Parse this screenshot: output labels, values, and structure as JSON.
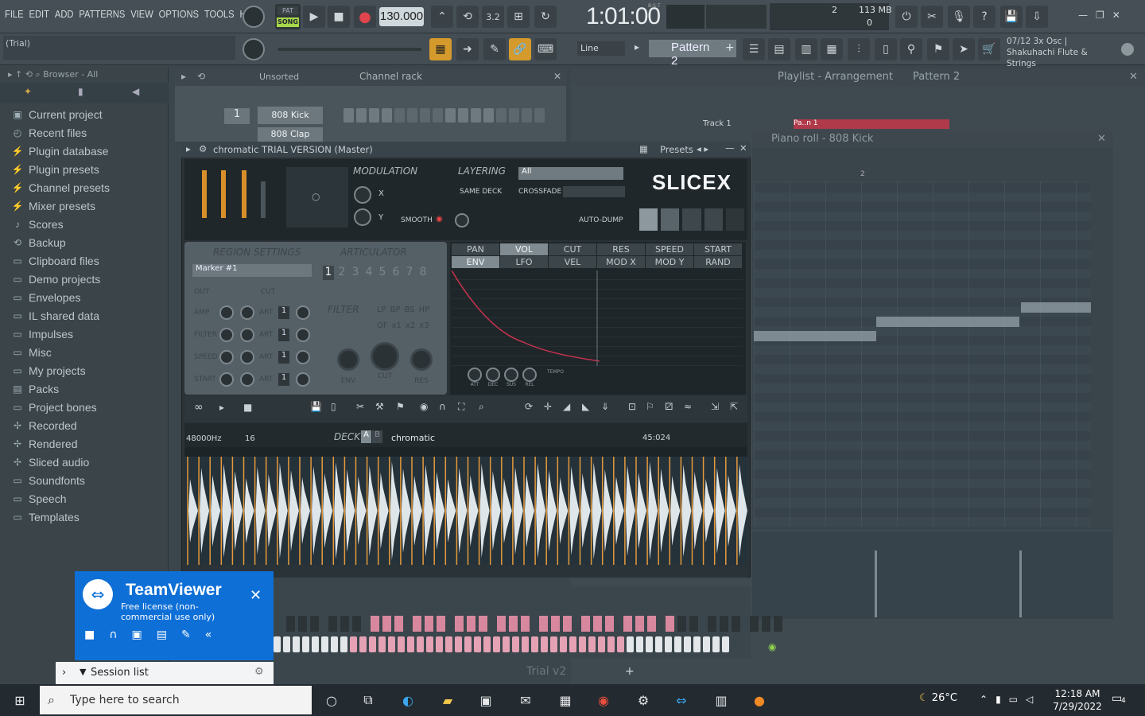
{
  "menu": [
    "FILE",
    "EDIT",
    "ADD",
    "PATTERNS",
    "VIEW",
    "OPTIONS",
    "TOOLS",
    "HELP"
  ],
  "transport": {
    "pat": "PAT",
    "song": "SONG",
    "tempo": "130.000",
    "timecode": "1:01:00",
    "bst": "B:S:T"
  },
  "monitor": {
    "cpu": "2",
    "memory": "113 MB",
    "voices": "0"
  },
  "hint": "(Trial)",
  "snap": "Line",
  "pattern": "Pattern 2",
  "info": {
    "line1": "07/12  3x Osc |",
    "line2": "Shakuhachi Flute & Strings"
  },
  "browser": {
    "title": "Browser - All",
    "items": [
      {
        "icon": "project-icon",
        "label": "Current project"
      },
      {
        "icon": "recent-icon",
        "label": "Recent files"
      },
      {
        "icon": "plugin-icon",
        "label": "Plugin database"
      },
      {
        "icon": "plugin-icon",
        "label": "Plugin presets"
      },
      {
        "icon": "preset-icon",
        "label": "Channel presets"
      },
      {
        "icon": "preset-icon",
        "label": "Mixer presets"
      },
      {
        "icon": "note-icon",
        "label": "Scores"
      },
      {
        "icon": "backup-icon",
        "label": "Backup"
      },
      {
        "icon": "folder-icon",
        "label": "Clipboard files"
      },
      {
        "icon": "folder-icon",
        "label": "Demo projects"
      },
      {
        "icon": "folder-icon",
        "label": "Envelopes"
      },
      {
        "icon": "folder-icon",
        "label": "IL shared data"
      },
      {
        "icon": "folder-icon",
        "label": "Impulses"
      },
      {
        "icon": "folder-icon",
        "label": "Misc"
      },
      {
        "icon": "folder-icon",
        "label": "My projects"
      },
      {
        "icon": "packs-icon",
        "label": "Packs"
      },
      {
        "icon": "folder-icon",
        "label": "Project bones"
      },
      {
        "icon": "audio-icon",
        "label": "Recorded"
      },
      {
        "icon": "audio-icon",
        "label": "Rendered"
      },
      {
        "icon": "audio-icon",
        "label": "Sliced audio"
      },
      {
        "icon": "folder-icon",
        "label": "Soundfonts"
      },
      {
        "icon": "folder-icon",
        "label": "Speech"
      },
      {
        "icon": "folder-icon",
        "label": "Templates"
      }
    ]
  },
  "channel_rack": {
    "filter": "Unsorted",
    "title": "Channel rack",
    "channel_number": "1",
    "channel1": "808 Kick",
    "channel2": "808 Clap"
  },
  "playlist": {
    "title": "Playlist - Arrangement",
    "pattern": "Pattern 2",
    "track": "Track 1",
    "clip": "Pa..n 1"
  },
  "piano_roll": {
    "title": "Piano roll - 808 Kick",
    "bar": "2"
  },
  "slicex": {
    "title": "chromatic TRIAL VERSION (Master)",
    "presets": "Presets",
    "modulation": "MODULATION",
    "x": "X",
    "y": "Y",
    "smooth": "SMOOTH",
    "layering": "LAYERING",
    "layer_value": "All",
    "same_deck": "SAME DECK",
    "crossfade": "CROSSFADE",
    "auto_dump": "AUTO-DUMP",
    "logo": "SLICEX",
    "region": "REGION SETTINGS",
    "marker": "Marker #1",
    "out": "OUT",
    "cut": "CUT",
    "rows": [
      "AMP",
      "FILTER",
      "SPEED",
      "START"
    ],
    "art": "ART",
    "articulator": "ARTICULATOR",
    "art_numbers": [
      "1",
      "2",
      "3",
      "4",
      "5",
      "6",
      "7",
      "8"
    ],
    "filter": "FILTER",
    "filter_types": [
      "LP",
      "BP",
      "BS",
      "HP"
    ],
    "filter_mult": [
      "OF",
      "x1",
      "x2",
      "x3"
    ],
    "knobs": [
      "ENV",
      "CUT",
      "RES"
    ],
    "tabs_top": [
      "PAN",
      "VOL",
      "CUT",
      "RES",
      "SPEED",
      "START"
    ],
    "tabs_bottom": [
      "ENV",
      "LFO",
      "VEL",
      "MOD X",
      "MOD Y",
      "RAND"
    ],
    "adsr": [
      "ATT",
      "DEC",
      "SUS",
      "REL"
    ],
    "tempo_label": "TEMPO",
    "samplerate": "48000Hz",
    "format": "16",
    "deck": "DECK",
    "deck_a": "A",
    "deck_b": "B",
    "sample_title": "chromatic",
    "length": "45:024"
  },
  "teamviewer": {
    "name": "TeamViewer",
    "license": "Free license (non-commercial use only)",
    "session": "Session list"
  },
  "watermark": "Trial v2",
  "taskbar": {
    "search": "Type here to search",
    "weather": "26°C",
    "time": "12:18 AM",
    "date": "7/29/2022",
    "notif": "4"
  }
}
